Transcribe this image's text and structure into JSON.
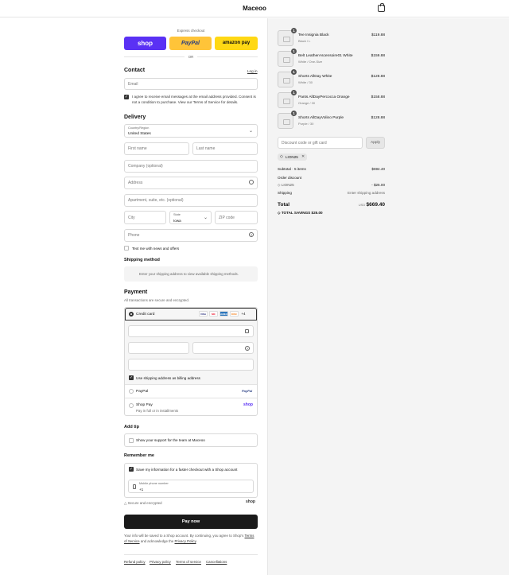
{
  "header": {
    "brand": "Maceoo"
  },
  "express": {
    "label": "Express checkout",
    "shop": "shop",
    "paypal": "PayPal",
    "amazon": "amazon pay",
    "or": "OR"
  },
  "contact": {
    "title": "Contact",
    "login": "Log in",
    "email_placeholder": "Email",
    "consent": "I agree to receive email messages at the email address provided. Consent is not a condition to purchase. View our Terms of Service for details."
  },
  "delivery": {
    "title": "Delivery",
    "country_label": "Country/Region",
    "country_value": "United States",
    "first_name": "First name",
    "last_name": "Last name",
    "company": "Company (optional)",
    "address": "Address",
    "apartment": "Apartment, suite, etc. (optional)",
    "city": "City",
    "state_label": "State",
    "state_value": "Iowa",
    "zip": "ZIP code",
    "phone": "Phone",
    "news": "Text me with news and offers"
  },
  "shipping": {
    "title": "Shipping method",
    "note": "Enter your shipping address to view available shipping methods."
  },
  "payment": {
    "title": "Payment",
    "subtitle": "All transactions are secure and encrypted.",
    "credit_card": "Credit card",
    "cards": [
      "VISA",
      "MC",
      "AMEX",
      "DISC"
    ],
    "more": "+4",
    "billing": "Use shipping address as billing address",
    "paypal": "PayPal",
    "paypal_logo": "PayPal",
    "shoppay": "Shop Pay",
    "shoppay_sub": "Pay in full or in installments",
    "shoppay_logo": "shop"
  },
  "tip": {
    "title": "Add tip",
    "text": "Show your support for the team at Maceoo"
  },
  "remember": {
    "title": "Remember me",
    "save": "Save my information for a faster checkout with a Shop account",
    "mobile_label": "Mobile phone number",
    "mobile_value": "+1",
    "secure": "Secure and encrypted",
    "shop": "shop"
  },
  "pay_button": "Pay now",
  "legal": {
    "pre": "Your info will be saved to a Shop account. By continuing, you agree to Shop’s",
    "tos": "Terms of Service",
    "mid": "and acknowledge the",
    "privacy": "Privacy Policy",
    "end": "."
  },
  "footer_links": [
    "Refund policy",
    "Privacy policy",
    "Terms of service",
    "Cancellations"
  ],
  "cart": {
    "items": [
      {
        "qty": "1",
        "name": "Tee Insignia Black",
        "variant": "Black / L",
        "price": "$119.88"
      },
      {
        "qty": "1",
        "name": "Belt LeatherAscensoire01 White",
        "variant": "White / One-Size",
        "price": "$159.88"
      },
      {
        "qty": "1",
        "name": "Shorts AllDay White",
        "variant": "White / 30",
        "price": "$128.88"
      },
      {
        "qty": "1",
        "name": "Pants AllDayPercocca Orange",
        "variant": "Orange / 30",
        "price": "$158.88"
      },
      {
        "qty": "1",
        "name": "Shorts AllDayVolino Purple",
        "variant": "Purple / 30",
        "price": "$128.88"
      }
    ],
    "discount_placeholder": "Discount code or gift card",
    "apply": "Apply",
    "code_tag": "LION25",
    "subtotal_label": "Subtotal · 5 items",
    "subtotal": "$694.40",
    "order_discount": "Order discount",
    "discount_code": "LION25",
    "discount_value": "- $25.00",
    "shipping_label": "Shipping",
    "shipping_value": "Enter shipping address",
    "total_label": "Total",
    "currency": "USD",
    "total": "$669.40",
    "savings_label": "TOTAL SAVINGS",
    "savings": "$25.00"
  }
}
